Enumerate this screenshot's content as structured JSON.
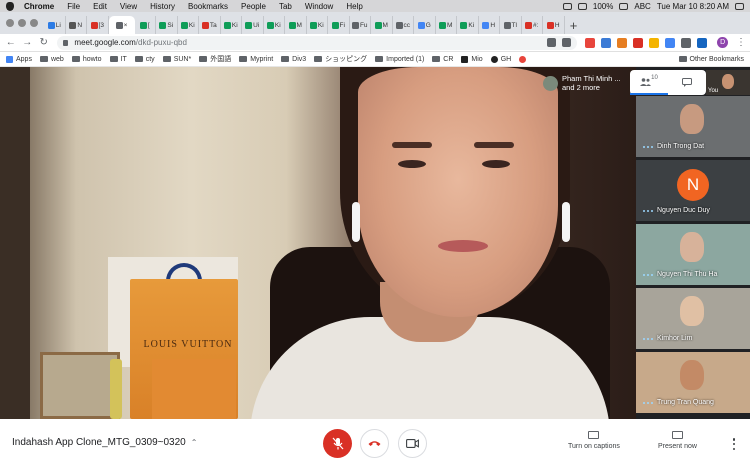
{
  "menubar": {
    "app": "Chrome",
    "items": [
      "File",
      "Edit",
      "View",
      "History",
      "Bookmarks",
      "People",
      "Tab",
      "Window",
      "Help"
    ],
    "battery": "100%",
    "input_source": "ABC",
    "clock": "Tue Mar 10  8:20 AM"
  },
  "tabs": [
    {
      "label": "Li",
      "color": "#2c7be5"
    },
    {
      "label": "N",
      "color": "#555555"
    },
    {
      "label": "[3",
      "color": "#d93025"
    },
    {
      "label": "×",
      "color": "#5f6368",
      "active": true
    },
    {
      "label": "[",
      "color": "#0f9d58"
    },
    {
      "label": "Si",
      "color": "#0f9d58"
    },
    {
      "label": "Ki",
      "color": "#0f9d58"
    },
    {
      "label": "Ta",
      "color": "#d93025"
    },
    {
      "label": "Ki",
      "color": "#0f9d58"
    },
    {
      "label": "Ui",
      "color": "#0f9d58"
    },
    {
      "label": "Ki",
      "color": "#0f9d58"
    },
    {
      "label": "M",
      "color": "#0f9d58"
    },
    {
      "label": "Ki",
      "color": "#0f9d58"
    },
    {
      "label": "Fi",
      "color": "#0f9d58"
    },
    {
      "label": "Fu",
      "color": "#5f6368"
    },
    {
      "label": "M",
      "color": "#0f9d58"
    },
    {
      "label": "cc",
      "color": "#5f6368"
    },
    {
      "label": "G",
      "color": "#4285f4"
    },
    {
      "label": "M",
      "color": "#0f9d58"
    },
    {
      "label": "Ki",
      "color": "#0f9d58"
    },
    {
      "label": "H",
      "color": "#4285f4"
    },
    {
      "label": "Tl",
      "color": "#5f6368"
    },
    {
      "label": "#:",
      "color": "#d93025"
    },
    {
      "label": "H",
      "color": "#d93025"
    }
  ],
  "toolbar": {
    "url_host": "meet.google.com",
    "url_path": "/dkd-puxu-qbd",
    "profile_initial": "D"
  },
  "bookmarks": [
    {
      "label": "Apps",
      "icon": "apps-grid-icon"
    },
    {
      "label": "web",
      "icon": "folder-icon"
    },
    {
      "label": "howto",
      "icon": "folder-icon"
    },
    {
      "label": "IT",
      "icon": "folder-icon"
    },
    {
      "label": "cty",
      "icon": "folder-icon"
    },
    {
      "label": "SUN*",
      "icon": "folder-icon"
    },
    {
      "label": "外国語",
      "icon": "folder-icon"
    },
    {
      "label": "Myprint",
      "icon": "folder-icon"
    },
    {
      "label": "Div3",
      "icon": "folder-icon"
    },
    {
      "label": "ショッピング",
      "icon": "folder-icon"
    },
    {
      "label": "Imported (1)",
      "icon": "folder-icon"
    },
    {
      "label": "CR",
      "icon": "folder-icon"
    },
    {
      "label": "Mio",
      "icon": "mio-icon"
    },
    {
      "label": "GH",
      "icon": "github-icon"
    },
    {
      "label": "",
      "icon": "gem-icon"
    }
  ],
  "other_bookmarks": "Other Bookmarks",
  "meet": {
    "main_video_brand": "LOUIS VUITTON",
    "chip_name": "Pham Thi Minh ...",
    "chip_more": "and 2 more",
    "participant_count": "10",
    "self_label": "You",
    "participants": [
      {
        "name": "Dinh Trong Dat",
        "bg": "#6b6e70",
        "face": "#c79a80"
      },
      {
        "name": "Nguyen Duc Duy",
        "initial": "N"
      },
      {
        "name": "Nguyen Thi Thu Ha",
        "bg": "#8ca7a0",
        "face": "#d7b29a"
      },
      {
        "name": "Kimhor Lim",
        "bg": "#a8a49a",
        "face": "#e0c0a4"
      },
      {
        "name": "Trung Tran Quang",
        "bg": "#c7a98a",
        "face": "#c38a66"
      }
    ]
  },
  "bottom": {
    "meeting_title": "Indahash App Clone_MTG_0309~0320",
    "captions_label": "Turn on captions",
    "present_label": "Present now"
  }
}
